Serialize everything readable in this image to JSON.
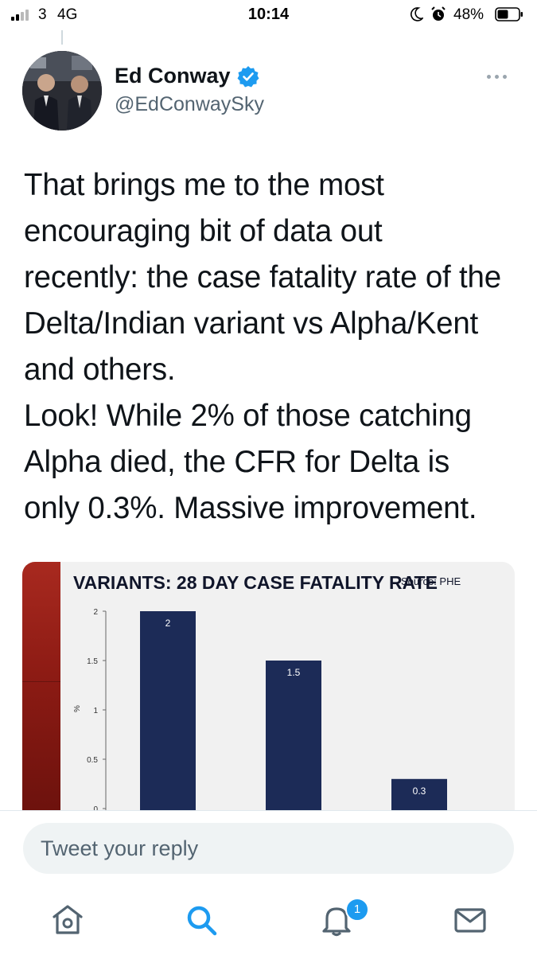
{
  "status_bar": {
    "carrier": "3",
    "network": "4G",
    "time": "10:14",
    "battery_percent": "48%",
    "icons": [
      "signal-icon",
      "moon-icon",
      "alarm-icon",
      "battery-icon"
    ]
  },
  "tweet": {
    "author_name": "Ed Conway",
    "handle": "@EdConwaySky",
    "verified": true,
    "text": "That brings me to the most\nencouraging bit of data out\nrecently: the case fatality rate of the\nDelta/Indian variant vs Alpha/Kent\nand others.\nLook! While 2% of those catching\nAlpha died, the CFR for Delta is\nonly 0.3%. Massive improvement."
  },
  "chart_data": {
    "type": "bar",
    "title": "VARIANTS: 28 DAY CASE FATALITY RATE",
    "source": "Source: PHE",
    "ylabel": "%",
    "yticks": [
      "2",
      "1.5",
      "1",
      "0.5",
      "0"
    ],
    "ylim": [
      0,
      2.0
    ],
    "values": [
      2,
      1.5,
      0.3
    ],
    "value_labels": [
      "2",
      "1.5",
      "0.3"
    ],
    "bar_color": "#1c2b57"
  },
  "reply": {
    "placeholder": "Tweet your reply"
  },
  "tab_bar": {
    "items": [
      "home-icon",
      "search-icon",
      "notifications-icon",
      "messages-icon"
    ],
    "notification_count": "1",
    "active_color": "#1d9bf0",
    "inactive_color": "#1d9bf0"
  },
  "colors": {
    "accent": "#1d9bf0",
    "verified": "#1d9bf0",
    "text_primary": "#0f1419",
    "text_secondary": "#536471"
  }
}
